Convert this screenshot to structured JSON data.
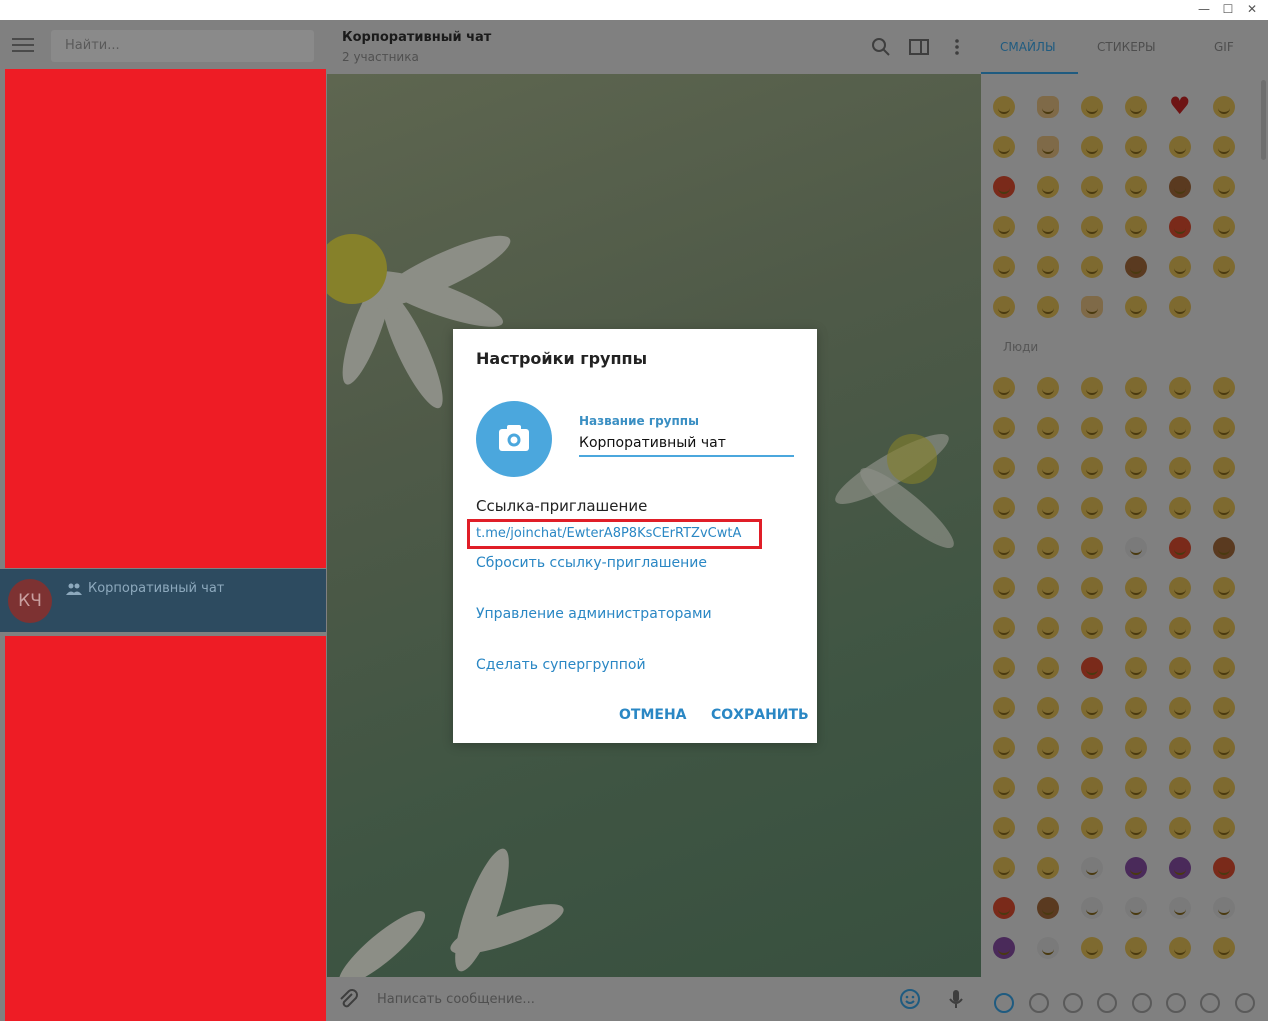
{
  "window": {
    "minimize": "—",
    "maximize": "☐",
    "close": "✕"
  },
  "sidebar": {
    "search_placeholder": "Найти...",
    "chat": {
      "avatar_initials": "КЧ",
      "name": "Корпоративный чат"
    }
  },
  "chat": {
    "title": "Корпоративный чат",
    "subtitle": "2 участника",
    "composer_placeholder": "Написать сообщение..."
  },
  "emoji_panel": {
    "tabs": [
      "СМАЙЛЫ",
      "СТИКЕРЫ",
      "GIF"
    ],
    "active_tab": "СМАЙЛЫ",
    "section_label": "Люди"
  },
  "dialog": {
    "title": "Настройки группы",
    "name_label": "Название группы",
    "name_value": "Корпоративный чат",
    "invite_label": "Ссылка-приглашение",
    "invite_link": "t.me/joinchat/EwterA8P8KsCErRTZvCwtA",
    "reset_link": "Сбросить ссылку-приглашение",
    "manage_admins": "Управление администраторами",
    "make_supergroup": "Сделать супергруппой",
    "cancel": "ОТМЕНА",
    "save": "СОХРАНИТЬ"
  },
  "colors": {
    "accent": "#4ba7dd",
    "link": "#2a87c4",
    "highlight": "#e01e28",
    "redacted": "#ee1c25"
  }
}
